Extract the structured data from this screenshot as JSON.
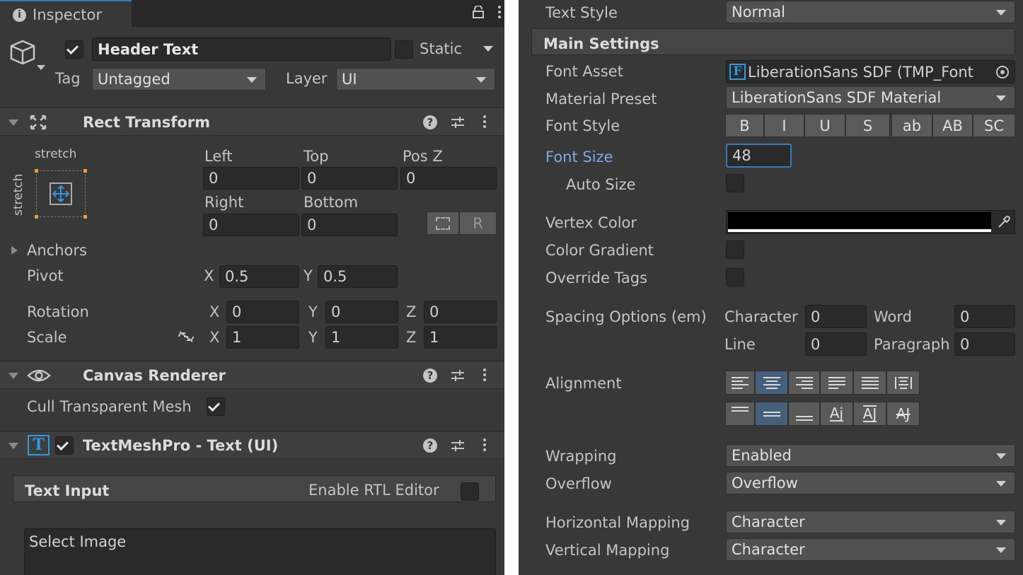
{
  "inspector": {
    "tab_label": "Inspector",
    "object_name": "Header Text",
    "static_label": "Static",
    "tag_label": "Tag",
    "tag_value": "Untagged",
    "layer_label": "Layer",
    "layer_value": "UI",
    "active_checked": true,
    "static_checked": false
  },
  "rect_transform": {
    "title": "Rect Transform",
    "anchor_h": "stretch",
    "anchor_v": "stretch",
    "left_label": "Left",
    "left": "0",
    "top_label": "Top",
    "top": "0",
    "posz_label": "Pos Z",
    "posz": "0",
    "right_label": "Right",
    "right": "0",
    "bottom_label": "Bottom",
    "bottom": "0",
    "r_button": "R",
    "anchors_label": "Anchors",
    "pivot_label": "Pivot",
    "pivot_x": "0.5",
    "pivot_y": "0.5",
    "rotation_label": "Rotation",
    "rot_x": "0",
    "rot_y": "0",
    "rot_z": "0",
    "scale_label": "Scale",
    "scale_x": "1",
    "scale_y": "1",
    "scale_z": "1",
    "x_label": "X",
    "y_label": "Y",
    "z_label": "Z"
  },
  "canvas_renderer": {
    "title": "Canvas Renderer",
    "cull_label": "Cull Transparent Mesh",
    "cull_checked": true
  },
  "tmp": {
    "title": "TextMeshPro - Text (UI)",
    "enabled": true,
    "text_input_label": "Text Input",
    "rtl_label": "Enable RTL Editor",
    "text_value": "Select Image"
  },
  "settings": {
    "text_style_label": "Text Style",
    "text_style_value": "Normal",
    "main_settings_label": "Main Settings",
    "font_asset_label": "Font Asset",
    "font_asset_value": "LiberationSans SDF (TMP_Font",
    "font_asset_icon": "F",
    "material_preset_label": "Material Preset",
    "material_preset_value": "LiberationSans SDF Material",
    "font_style_label": "Font Style",
    "font_style_buttons": [
      "B",
      "I",
      "U",
      "S",
      "ab",
      "AB",
      "SC"
    ],
    "font_size_label": "Font Size",
    "font_size_value": "48",
    "auto_size_label": "Auto Size",
    "vertex_color_label": "Vertex Color",
    "vertex_color": "#000000",
    "color_gradient_label": "Color Gradient",
    "override_tags_label": "Override Tags",
    "spacing_label": "Spacing Options (em)",
    "character_label": "Character",
    "character_value": "0",
    "word_label": "Word",
    "word_value": "0",
    "line_label": "Line",
    "line_value": "0",
    "paragraph_label": "Paragraph",
    "paragraph_value": "0",
    "alignment_label": "Alignment",
    "wrapping_label": "Wrapping",
    "wrapping_value": "Enabled",
    "overflow_label": "Overflow",
    "overflow_value": "Overflow",
    "hmap_label": "Horizontal Mapping",
    "hmap_value": "Character",
    "vmap_label": "Vertical Mapping",
    "vmap_value": "Character"
  },
  "colors": {
    "panel_bg": "#383838",
    "field_bg": "#2a2a2a",
    "accent_label": "#7fa7e6",
    "active_button": "#46607c",
    "icon_blue": "#2d9ae6"
  }
}
